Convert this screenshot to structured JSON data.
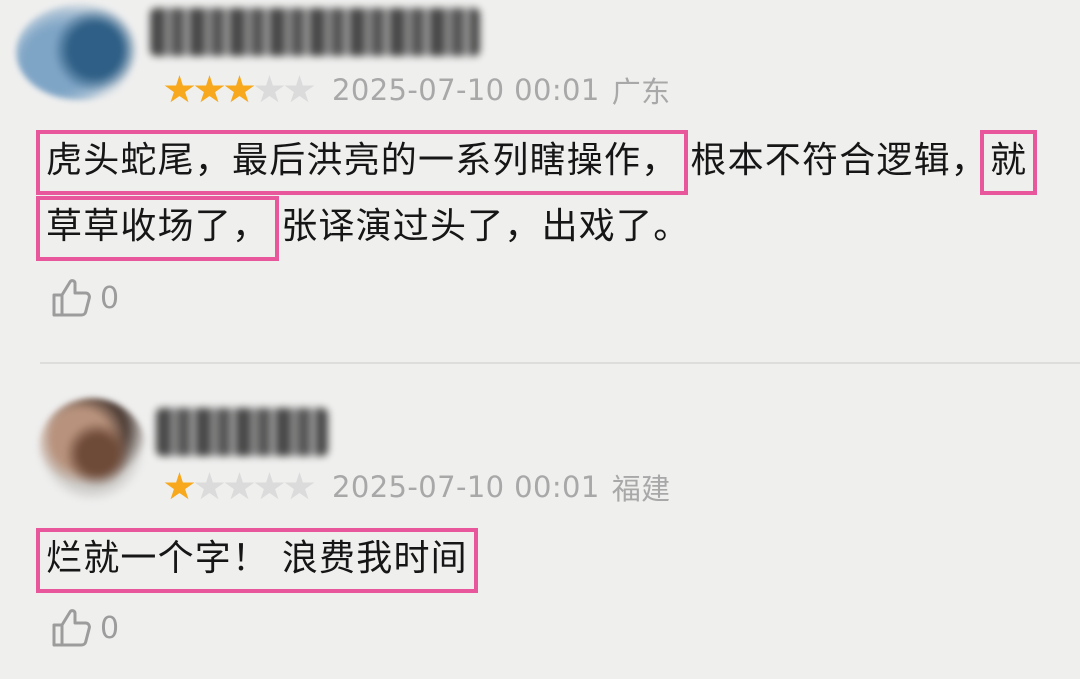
{
  "comments": [
    {
      "rating": 3,
      "max_rating": 5,
      "date": "2025-07-10 00:01",
      "region": "广东",
      "text_parts": [
        {
          "text": "虎头蛇尾，最后洪亮的一系列瞎操作，",
          "highlight": true
        },
        {
          "text": "根本不符合逻辑，",
          "highlight": false
        },
        {
          "text": "就草草收场了，",
          "highlight": true
        },
        {
          "text": "张译演过头了，出戏了。",
          "highlight": false
        }
      ],
      "likes": "0"
    },
    {
      "rating": 1,
      "max_rating": 5,
      "date": "2025-07-10 00:01",
      "region": "福建",
      "text_parts": [
        {
          "text": "烂就一个字！ 浪费我时间",
          "highlight": true
        }
      ],
      "likes": "0"
    }
  ],
  "colors": {
    "star_on": "#f7a81c",
    "star_off": "#dbdbdb",
    "highlight_border": "#e8569c",
    "meta_text": "#a8a8a8"
  },
  "icons": {
    "like": "thumbs-up-outline-icon",
    "star": "star-icon"
  }
}
